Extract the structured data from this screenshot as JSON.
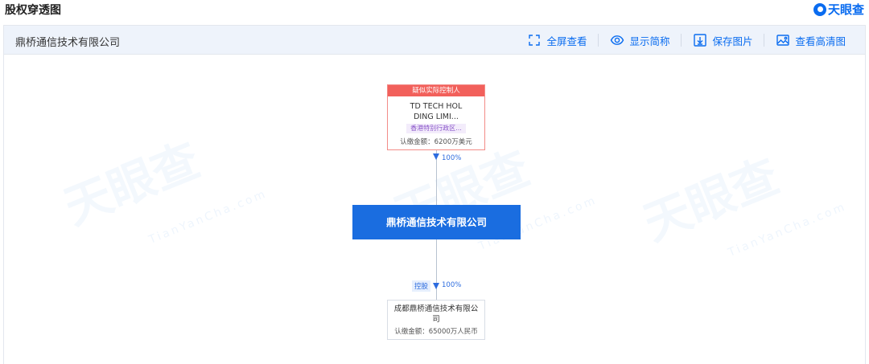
{
  "header": {
    "title": "股权穿透图",
    "brand": "天眼查"
  },
  "panel": {
    "company_name": "鼎桥通信技术有限公司",
    "toolbar": {
      "fullscreen": "全屏查看",
      "show_short": "显示简称",
      "save_image": "保存图片",
      "view_hd": "查看高清图"
    }
  },
  "watermark": {
    "text": "天眼查",
    "sub": "TianYanCha.com"
  },
  "tree": {
    "controller": {
      "badge": "疑似实际控制人",
      "name_line1": "TD TECH HOL",
      "name_line2": "DING LIMI...",
      "region": "香港特别行政区...",
      "capital": "认缴金额：6200万美元",
      "percent": "100%"
    },
    "main": {
      "name": "鼎桥通信技术有限公司"
    },
    "subsidiary": {
      "relation": "控股",
      "percent": "100%",
      "name_line1": "成都鼎桥通信技术有限公",
      "name_line2": "司",
      "capital": "认缴金额：65000万人民币"
    }
  },
  "colors": {
    "accent": "#0a6cf0",
    "main_node": "#1a6de0",
    "controller_head": "#f2605b"
  }
}
